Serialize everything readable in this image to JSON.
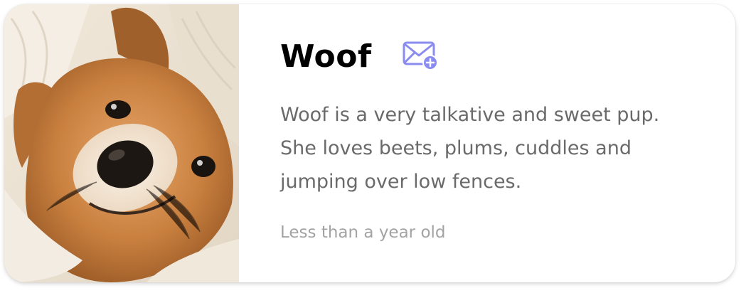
{
  "card": {
    "title": "Woof",
    "description": "Woof is a very talkative and sweet pup. She loves beets, plums, cuddles and jumping over low fences.",
    "age": "Less than a year old",
    "action_icon": "mail-add-icon",
    "accent_color": "#8a8cf0",
    "photo_subject": "dog-photo"
  }
}
